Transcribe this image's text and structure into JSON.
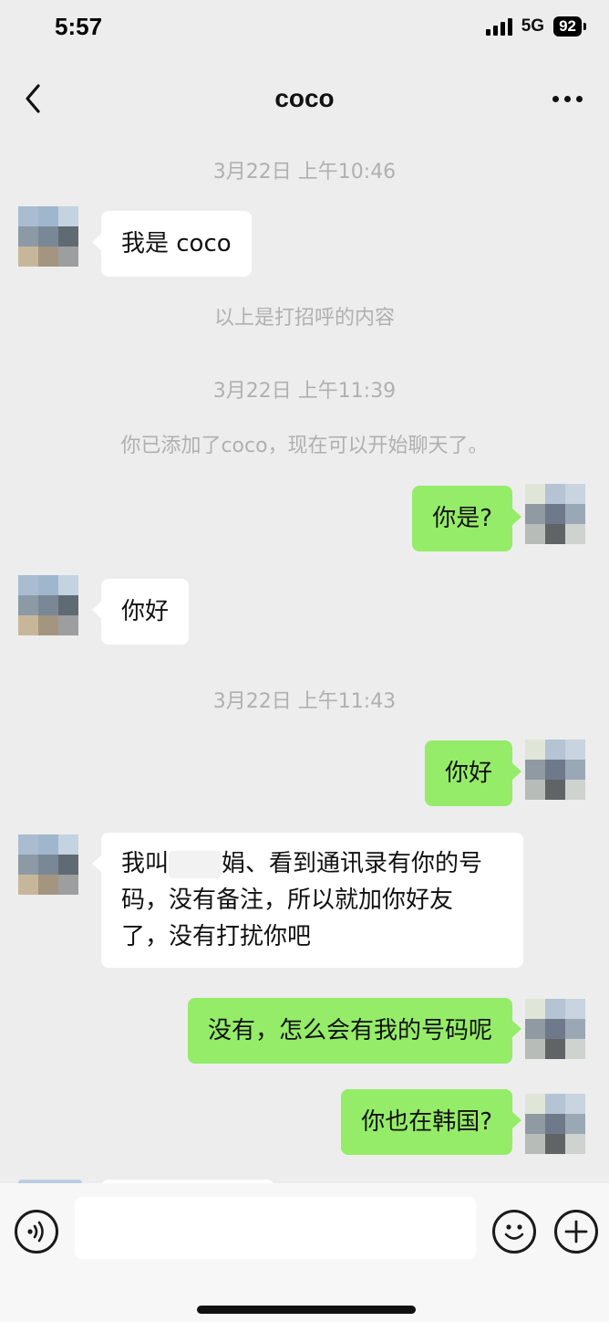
{
  "status": {
    "time": "5:57",
    "network": "5G",
    "battery": "92"
  },
  "nav": {
    "title": "coco"
  },
  "colors": {
    "outgoing_bubble": "#95ec69",
    "incoming_bubble": "#ffffff",
    "background": "#ededed",
    "system_text": "#b0b0b0"
  },
  "icons": {
    "back": "chevron-left-icon",
    "more": "more-dots-icon",
    "voice": "voice-icon",
    "emoji": "emoji-icon",
    "plus": "plus-icon"
  },
  "messages": {
    "ts1": "3月22日 上午10:46",
    "m1": "我是 coco",
    "sys_greeting": "以上是打招呼的内容",
    "ts2": "3月22日 上午11:39",
    "sys_added": "你已添加了coco，现在可以开始聊天了。",
    "m2": "你是?",
    "m3": "你好",
    "ts3": "3月22日 上午11:43",
    "m4": "你好",
    "m5_a": "我叫",
    "m5_b": "娟、看到通讯录有你的号",
    "m5_c": "码，没有备注，所以就加你好友",
    "m5_d": "了，没有打扰你吧",
    "m6": "没有，怎么会有我的号码呢",
    "m7": "你也在韩国?"
  },
  "input": {
    "placeholder": ""
  }
}
